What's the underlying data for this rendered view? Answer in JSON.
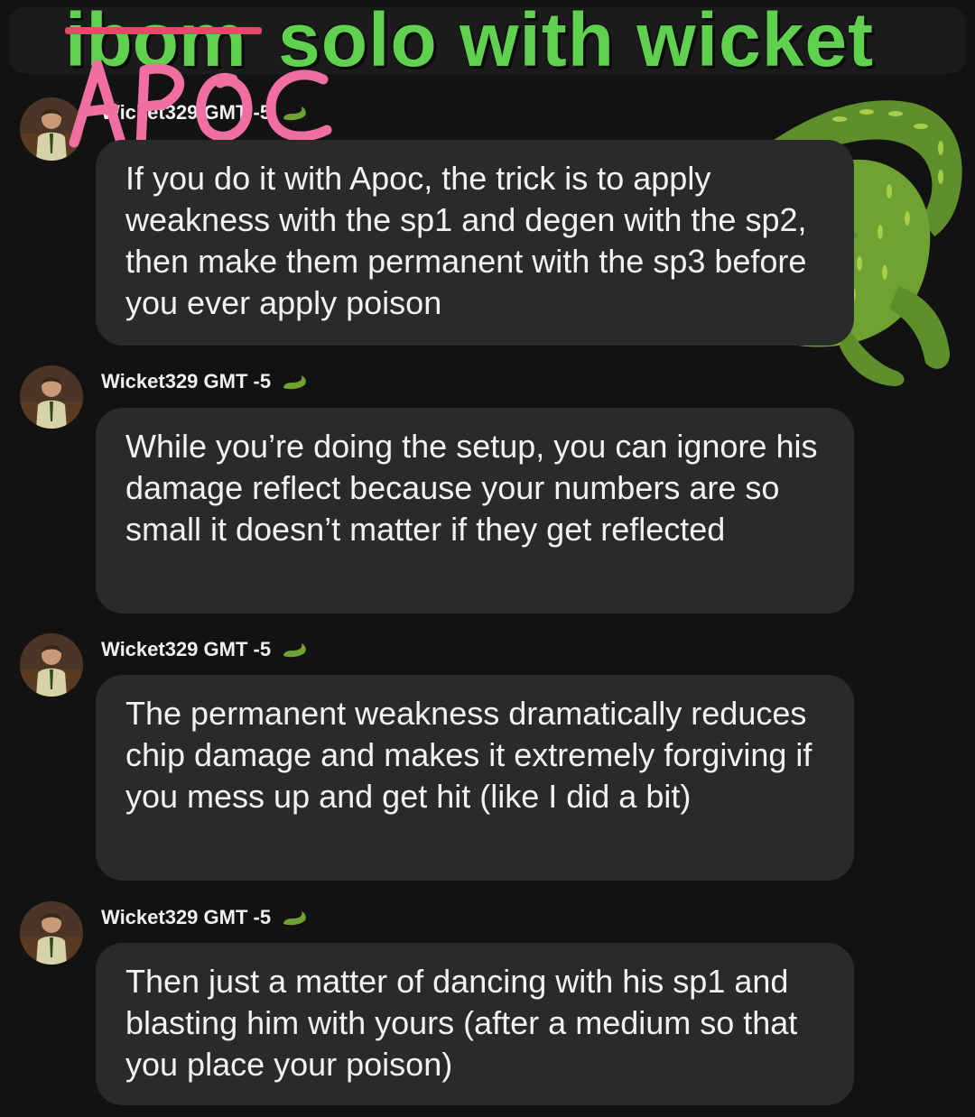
{
  "header": {
    "struck_word": "ibom",
    "handwritten_word": "Apoc",
    "title": "solo with wicket"
  },
  "messages": [
    {
      "username": "Wicket329 GMT -5",
      "text": "If you do it with Apoc, the trick is to apply weakness with the sp1 and degen with the sp2, then make them permanent with the sp3 before you ever apply poison"
    },
    {
      "username": "Wicket329 GMT -5",
      "text": "While you’re doing the setup, you can ignore his damage reflect because your numbers are so small it doesn’t matter if they get reflected"
    },
    {
      "username": "Wicket329 GMT -5",
      "text": "The permanent weakness dramatically reduces chip damage and makes it extremely forgiving if you mess up and get hit (like I did a bit)"
    },
    {
      "username": "Wicket329 GMT -5",
      "text": "Then just a matter of dancing with his sp1 and blasting him with yours (after a medium so that you place your poison)"
    }
  ],
  "icons": {
    "avatar": "user-avatar",
    "badge": "crocodile-icon",
    "sticker": "crocodile-sticker"
  },
  "colors": {
    "background": "#121212",
    "bubble": "#2a2a2a",
    "title_green": "#5fd14f",
    "scribble_pink": "#f06fa0"
  }
}
